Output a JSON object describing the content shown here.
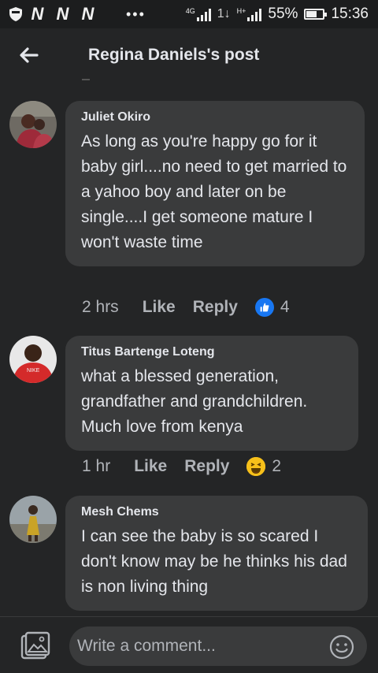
{
  "status_bar": {
    "carriers": [
      "N",
      "N",
      "N"
    ],
    "overflow": "•••",
    "sig1_label": "4G",
    "data_arrows": "1↓",
    "sig2_label": "H+",
    "battery_percent_text": "55%",
    "battery_level": 0.55,
    "time": "15:36"
  },
  "header": {
    "title": "Regina Daniels's post",
    "back_icon": "arrow-left-icon"
  },
  "comments": [
    {
      "author": "Juliet Okiro",
      "text": "As long as you're happy go for it baby girl....no need to get married to a yahoo boy and later on be single....I get someone mature I won't waste time",
      "time": "2 hrs",
      "like_label": "Like",
      "reply_label": "Reply",
      "reaction_icon": "thumbs-up-icon",
      "reaction_count": "4"
    },
    {
      "author": "Titus Bartenge Loteng",
      "text": "what a blessed generation, grandfather and grandchildren. Much love from kenya",
      "time": "1 hr",
      "like_label": "Like",
      "reply_label": "Reply",
      "reaction_icon": "haha-icon",
      "reaction_count": "2"
    },
    {
      "author": "Mesh Chems",
      "text": "I can see the baby is so scared I don't know may be he thinks his dad is non living thing"
    }
  ],
  "composer": {
    "placeholder": "Write a comment...",
    "photo_icon": "photo-icon",
    "emoji_icon": "emoji-icon"
  },
  "colors": {
    "background": "#242526",
    "bubble": "#3a3b3c",
    "text_primary": "#e4e6eb",
    "text_secondary": "#b0b3b8",
    "like_blue": "#1877f2",
    "haha_yellow": "#f7c01a"
  }
}
